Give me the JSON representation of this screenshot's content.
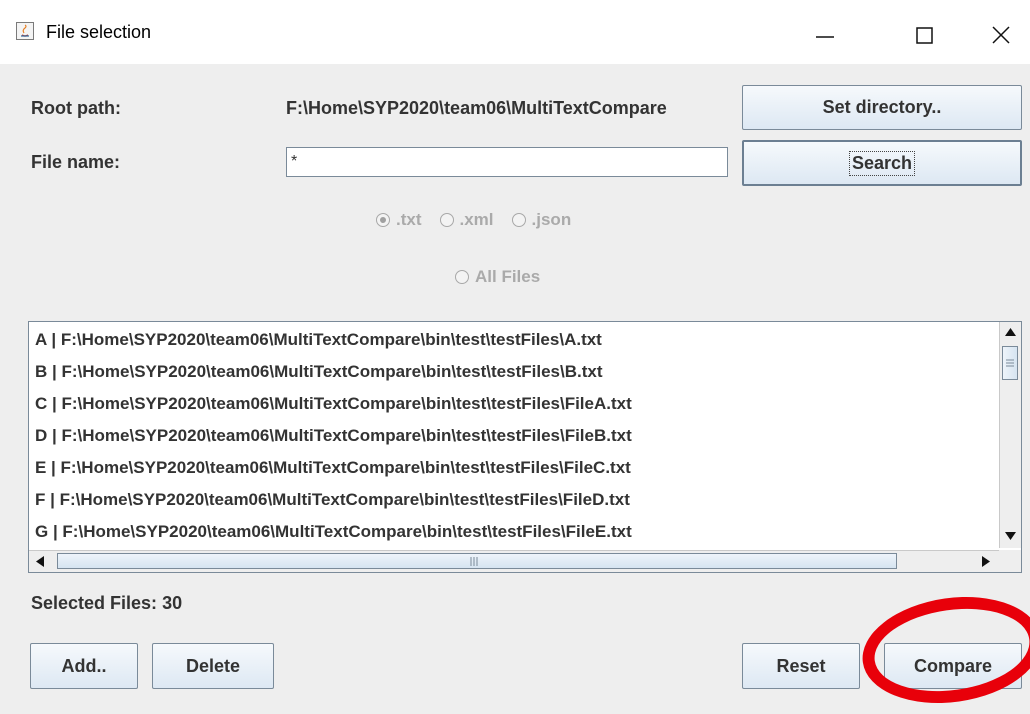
{
  "window": {
    "title": "File selection",
    "icon": "java-app-icon",
    "controls": [
      "minimize-icon",
      "maximize-icon",
      "close-icon"
    ]
  },
  "root": {
    "label": "Root path:",
    "value": "F:\\Home\\SYP2020\\team06\\MultiTextCompare",
    "button": "Set directory.."
  },
  "filename": {
    "label": "File name:",
    "value": "*",
    "button": "Search"
  },
  "filters": {
    "txt": ".txt",
    "xml": ".xml",
    "json": ".json",
    "all": "All Files",
    "selected": ".txt"
  },
  "files": [
    "A |  F:\\Home\\SYP2020\\team06\\MultiTextCompare\\bin\\test\\testFiles\\A.txt",
    "B |  F:\\Home\\SYP2020\\team06\\MultiTextCompare\\bin\\test\\testFiles\\B.txt",
    "C |  F:\\Home\\SYP2020\\team06\\MultiTextCompare\\bin\\test\\testFiles\\FileA.txt",
    "D |  F:\\Home\\SYP2020\\team06\\MultiTextCompare\\bin\\test\\testFiles\\FileB.txt",
    "E |  F:\\Home\\SYP2020\\team06\\MultiTextCompare\\bin\\test\\testFiles\\FileC.txt",
    "F |  F:\\Home\\SYP2020\\team06\\MultiTextCompare\\bin\\test\\testFiles\\FileD.txt",
    "G |  F:\\Home\\SYP2020\\team06\\MultiTextCompare\\bin\\test\\testFiles\\FileE.txt"
  ],
  "selected": {
    "label": "Selected Files:",
    "count": "30"
  },
  "buttons": {
    "add": "Add..",
    "delete": "Delete",
    "reset": "Reset",
    "compare": "Compare"
  },
  "colors": {
    "annotation": "#e8000a",
    "button_border": "#7a8a99"
  }
}
